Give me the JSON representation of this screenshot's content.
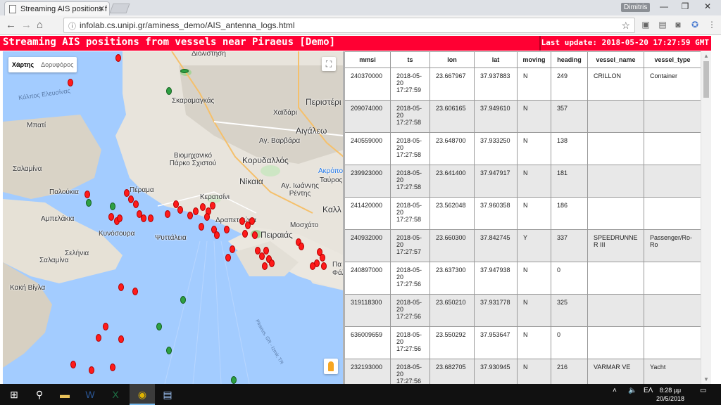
{
  "browser": {
    "tab_title": "Streaming AIS positions f",
    "user": "Dimitris",
    "url": "infolab.cs.unipi.gr/aminess_demo/AIS_antenna_logs.html"
  },
  "page": {
    "title": "Streaming AIS positions from vessels near Piraeus [Demo]",
    "last_update": "Last update: 2018-05-20 17:27:59 GMT"
  },
  "map": {
    "type_map": "Χάρτης",
    "type_satellite": "Δορυφόρος",
    "labels": [
      "Διολίστηση",
      "Κόλπος Ελευσίνας",
      "Σκαραμαγκάς",
      "Χαϊδάρι",
      "Περιστέρι",
      "Αιγάλεω",
      "Μπατί",
      "Αγ. Βαρβάρα",
      "Βιομηχανικό Πάρκο Σχιστού",
      "Κορυδαλλός",
      "Ακρόπολη",
      "Σαλαμίνα",
      "Παλούκια",
      "Πέραμα",
      "Κερατσίνι",
      "Νίκαια",
      "Αγ. Ιωάννης Ρέντης",
      "Ταύρος",
      "Καλλ",
      "Αμπελάκια",
      "Κυνόσουρα",
      "Δραπετσώνα",
      "Μοσχάτο",
      "Ψυττάλεια",
      "Πειραιάς",
      "Σελήνια",
      "Σαλαμίνα",
      "Κακή Βίγλα",
      "Πα",
      "Φάλ"
    ],
    "route_label": "Piraeus, GR - Izmir, TR"
  },
  "table": {
    "columns": [
      "mmsi",
      "ts",
      "lon",
      "lat",
      "moving",
      "heading",
      "vessel_name",
      "vessel_type"
    ],
    "rows": [
      {
        "mmsi": "240370000",
        "ts": "2018-05-20 17:27:59",
        "lon": "23.667967",
        "lat": "37.937883",
        "moving": "N",
        "heading": "249",
        "vessel_name": "CRILLON",
        "vessel_type": "Container"
      },
      {
        "mmsi": "209074000",
        "ts": "2018-05-20 17:27:58",
        "lon": "23.606165",
        "lat": "37.949610",
        "moving": "N",
        "heading": "357",
        "vessel_name": "",
        "vessel_type": ""
      },
      {
        "mmsi": "240559000",
        "ts": "2018-05-20 17:27:58",
        "lon": "23.648700",
        "lat": "37.933250",
        "moving": "N",
        "heading": "138",
        "vessel_name": "",
        "vessel_type": ""
      },
      {
        "mmsi": "239923000",
        "ts": "2018-05-20 17:27:58",
        "lon": "23.641400",
        "lat": "37.947917",
        "moving": "N",
        "heading": "181",
        "vessel_name": "",
        "vessel_type": ""
      },
      {
        "mmsi": "241420000",
        "ts": "2018-05-20 17:27:58",
        "lon": "23.562048",
        "lat": "37.960358",
        "moving": "N",
        "heading": "186",
        "vessel_name": "",
        "vessel_type": ""
      },
      {
        "mmsi": "240932000",
        "ts": "2018-05-20 17:27:57",
        "lon": "23.660300",
        "lat": "37.842745",
        "moving": "Y",
        "heading": "337",
        "vessel_name": "SPEEDRUNNER III",
        "vessel_type": "Passenger/Ro-Ro"
      },
      {
        "mmsi": "240897000",
        "ts": "2018-05-20 17:27:56",
        "lon": "23.637300",
        "lat": "37.947938",
        "moving": "N",
        "heading": "0",
        "vessel_name": "",
        "vessel_type": ""
      },
      {
        "mmsi": "319118300",
        "ts": "2018-05-20 17:27:56",
        "lon": "23.650210",
        "lat": "37.931778",
        "moving": "N",
        "heading": "325",
        "vessel_name": "",
        "vessel_type": ""
      },
      {
        "mmsi": "636009659",
        "ts": "2018-05-20 17:27:56",
        "lon": "23.550292",
        "lat": "37.953647",
        "moving": "N",
        "heading": "0",
        "vessel_name": "",
        "vessel_type": ""
      },
      {
        "mmsi": "232193000",
        "ts": "2018-05-20 17:27:56",
        "lon": "23.682705",
        "lat": "37.930945",
        "moving": "N",
        "heading": "216",
        "vessel_name": "VARMAR VE",
        "vessel_type": "Yacht"
      }
    ]
  },
  "taskbar": {
    "lang": "ΕΛ",
    "time": "8:28 μμ",
    "date": "20/5/2018"
  },
  "colors": {
    "header": "#ff0033",
    "vessel_stopped": "#ff1a1a",
    "vessel_moving": "#2ea043",
    "sea": "#a3ccff"
  }
}
